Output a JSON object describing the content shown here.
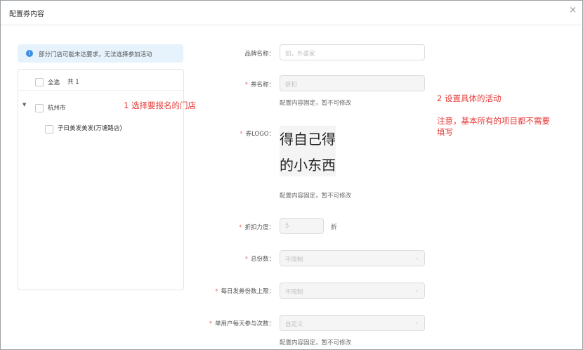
{
  "dialog": {
    "title": "配置券内容",
    "close_icon": "×"
  },
  "notice": {
    "icon": "i",
    "text": "部分门店可能未达要求，无法选择参加活动"
  },
  "store_tree": {
    "select_all_label": "全选",
    "total_label": "共 1",
    "city": {
      "label": "杭州市",
      "expand_icon": "▼"
    },
    "stores": [
      {
        "label": "子曰美发美发(万塘路店)"
      }
    ]
  },
  "annotations": {
    "step1": "1  选择要报名的门店",
    "step2": "2 设置具体的活动",
    "note_line1": "注意，基本所有的项目都不需要",
    "note_line2": "填写"
  },
  "form": {
    "brand": {
      "label": "品牌名称：",
      "placeholder": "如，外婆家"
    },
    "coupon_name": {
      "label": "券名称：",
      "value": "折扣",
      "hint": "配置内容固定，暂不可修改"
    },
    "logo": {
      "label": "券LOGO：",
      "image_line1": "得自己得",
      "image_line2": "的小东西",
      "hint": "配置内容固定，暂不可修改"
    },
    "discount": {
      "label": "折扣力度：",
      "value": "5",
      "unit": "折"
    },
    "total": {
      "label": "总份数：",
      "value": "不限制"
    },
    "daily_limit": {
      "label": "每日发券份数上限：",
      "value": "不限制"
    },
    "per_user": {
      "label": "单用户每天参与次数：",
      "value": "自定义",
      "hint": "配置内容固定，暂不可修改"
    }
  },
  "colors": {
    "required": "#f56c6c",
    "annotation": "#e53935",
    "notice_bg": "#e6f3fc",
    "info_icon": "#3a8ee6"
  }
}
